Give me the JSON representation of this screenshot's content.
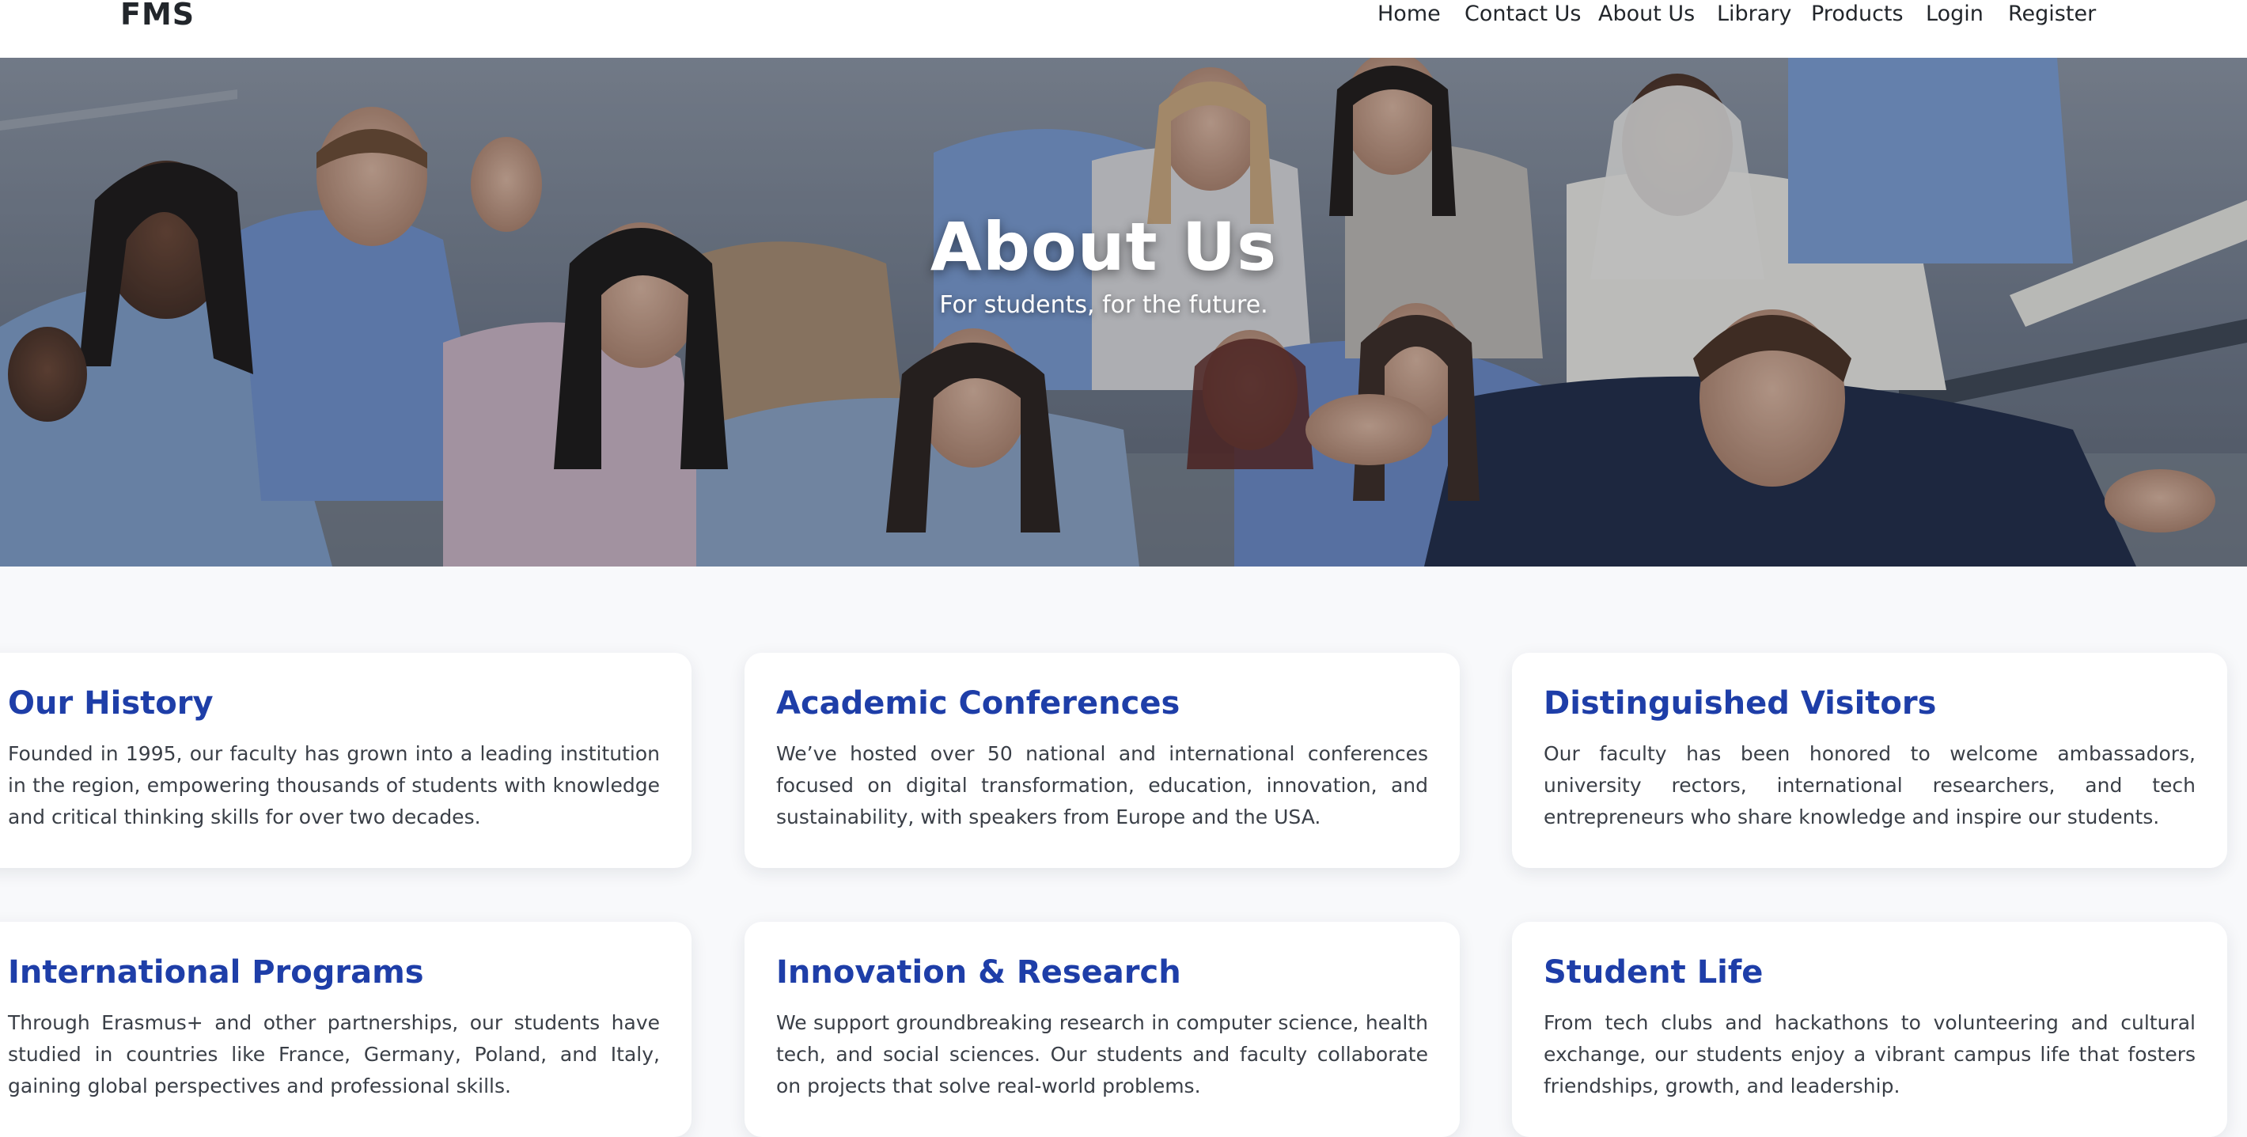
{
  "navbar": {
    "brand": "FMS",
    "links": [
      "Home",
      "Contact Us",
      "About Us",
      "Library",
      "Products",
      "Login",
      "Register"
    ]
  },
  "hero": {
    "title": "About Us",
    "subtitle": "For students, for the future."
  },
  "cards": [
    {
      "title": "Our History",
      "text": "Founded in 1995, our faculty has grown into a leading institution in the region, empowering thousands of students with knowledge and critical thinking skills for over two decades."
    },
    {
      "title": "Academic Conferences",
      "text": "We’ve hosted over 50 national and international conferences focused on digital transformation, education, innovation, and sustainability, with speakers from Europe and the USA."
    },
    {
      "title": "Distinguished Visitors",
      "text": "Our faculty has been honored to welcome ambassadors, university rectors, international researchers, and tech entrepreneurs who share knowledge and inspire our students."
    },
    {
      "title": "International Programs",
      "text": "Through Erasmus+ and other partnerships, our students have studied in countries like France, Germany, Poland, and Italy, gaining global perspectives and professional skills."
    },
    {
      "title": "Innovation & Research",
      "text": "We support groundbreaking research in computer science, health tech, and social sciences. Our students and faculty collaborate on projects that solve real-world problems."
    },
    {
      "title": "Student Life",
      "text": "From tech clubs and hackathons to volunteering and cultural exchange, our students enjoy a vibrant campus life that fosters friendships, growth, and leadership."
    }
  ]
}
